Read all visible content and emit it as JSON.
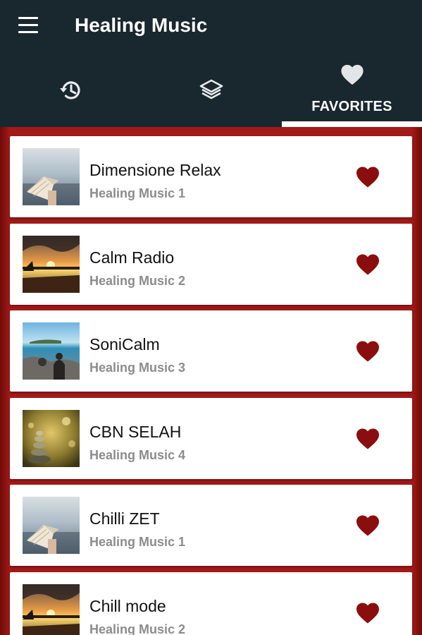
{
  "app": {
    "title": "Healing Music"
  },
  "tabs": [
    {
      "id": "recent",
      "icon": "history-icon",
      "label": ""
    },
    {
      "id": "categories",
      "icon": "layers-icon",
      "label": ""
    },
    {
      "id": "favorites",
      "icon": "heart-icon",
      "label": "FAVORITES",
      "selected": true
    }
  ],
  "colors": {
    "toolbar": "#19272f",
    "list_background": "#a41919",
    "heart": "#8b0e0e",
    "subtitle": "#8c8c8c"
  },
  "stations": [
    {
      "name": "Dimensione Relax",
      "subtitle": "Healing Music 1",
      "thumb": "book-seascape",
      "favorite": true
    },
    {
      "name": "Calm Radio",
      "subtitle": "Healing Music 2",
      "thumb": "sunset-lake",
      "favorite": true
    },
    {
      "name": "SoniCalm",
      "subtitle": "Healing Music 3",
      "thumb": "beach-rocks",
      "favorite": true
    },
    {
      "name": "CBN SELAH",
      "subtitle": "Healing Music 4",
      "thumb": "zen-stones",
      "favorite": true
    },
    {
      "name": "Chilli ZET",
      "subtitle": "Healing Music 1",
      "thumb": "book-seascape",
      "favorite": true
    },
    {
      "name": "Chill mode",
      "subtitle": "Healing Music 2",
      "thumb": "sunset-lake",
      "favorite": true
    }
  ]
}
